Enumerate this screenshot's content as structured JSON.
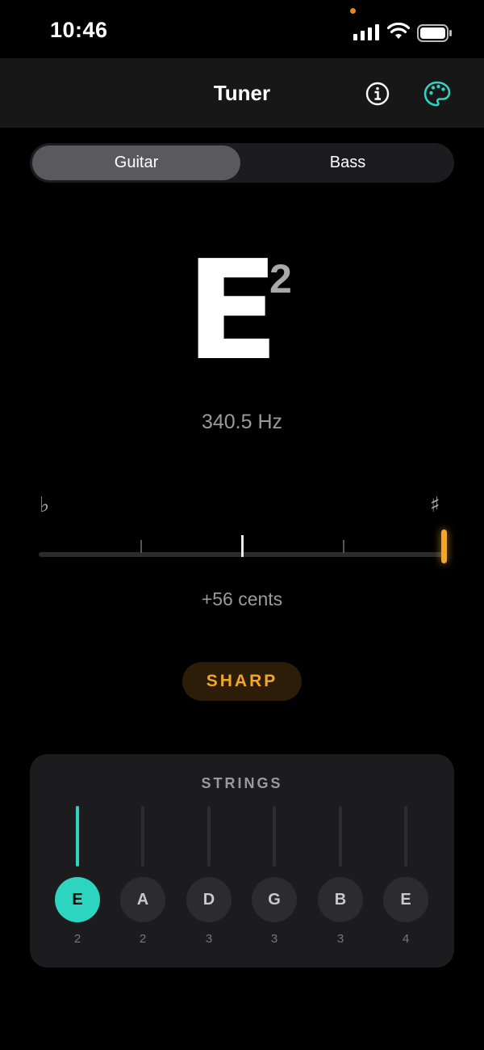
{
  "status_bar": {
    "time": "10:46"
  },
  "navbar": {
    "title": "Tuner",
    "info_icon": "info-icon",
    "palette_icon": "palette-icon"
  },
  "instrument_tabs": [
    {
      "label": "Guitar",
      "selected": true
    },
    {
      "label": "Bass",
      "selected": false
    }
  ],
  "tuner": {
    "note": "E",
    "octave": "2",
    "frequency": "340.5 Hz",
    "flat_symbol": "♭",
    "sharp_symbol": "♯",
    "cents_label": "+56 cents",
    "cents_value": 56,
    "status": "SHARP"
  },
  "colors": {
    "accent": "#2dd4bf",
    "sharp": "#f5a623",
    "background": "#000000",
    "card": "#1c1c1e"
  },
  "strings": {
    "title": "STRINGS",
    "items": [
      {
        "note": "E",
        "octave": "2",
        "active": true
      },
      {
        "note": "A",
        "octave": "2",
        "active": false
      },
      {
        "note": "D",
        "octave": "3",
        "active": false
      },
      {
        "note": "G",
        "octave": "3",
        "active": false
      },
      {
        "note": "B",
        "octave": "3",
        "active": false
      },
      {
        "note": "E",
        "octave": "4",
        "active": false
      }
    ]
  }
}
